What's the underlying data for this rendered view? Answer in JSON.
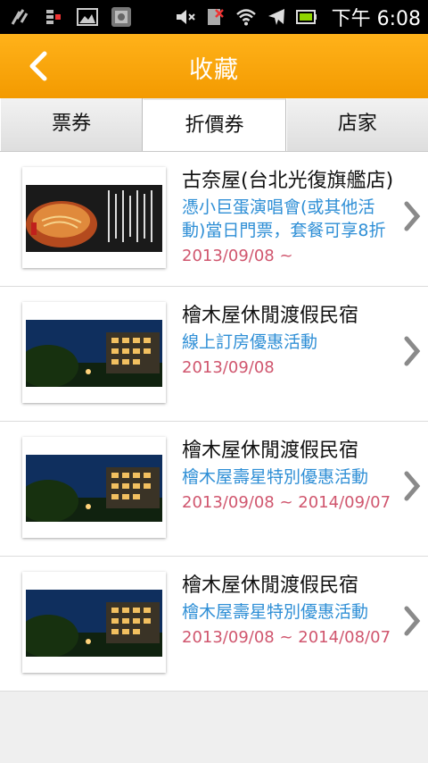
{
  "status_bar": {
    "time": "下午 6:08",
    "icons": [
      "usb-debug-icon",
      "sim-icon",
      "image-icon",
      "gallery-icon",
      "mute-icon",
      "no-signal-icon",
      "wifi-icon",
      "airplane-icon",
      "battery-icon"
    ]
  },
  "header": {
    "title": "收藏",
    "back_icon": "chevron-left-icon"
  },
  "tabs": [
    {
      "label": "票券",
      "active": false
    },
    {
      "label": "折價券",
      "active": true
    },
    {
      "label": "店家",
      "active": false
    }
  ],
  "items": [
    {
      "name": "古奈屋(台北光復旗艦店)",
      "description": "憑小巨蛋演唱會(或其他活動)當日門票，套餐可享8折",
      "date": "2013/09/08 ~",
      "thumbnail": "noodle-soup-image"
    },
    {
      "name": "檜木屋休閒渡假民宿",
      "description": "線上訂房優惠活動",
      "date": "2013/09/08",
      "thumbnail": "lodge-night-image"
    },
    {
      "name": "檜木屋休閒渡假民宿",
      "description": "檜木屋壽星特別優惠活動",
      "date": "2013/09/08 ~ 2014/09/07",
      "thumbnail": "lodge-night-image"
    },
    {
      "name": "檜木屋休閒渡假民宿",
      "description": "檜木屋壽星特別優惠活動",
      "date": "2013/09/08 ~ 2014/08/07",
      "thumbnail": "lodge-night-image"
    }
  ],
  "colors": {
    "header_orange": "#f5a000",
    "description_blue": "#2f8fd6",
    "date_pink": "#d0566e"
  }
}
